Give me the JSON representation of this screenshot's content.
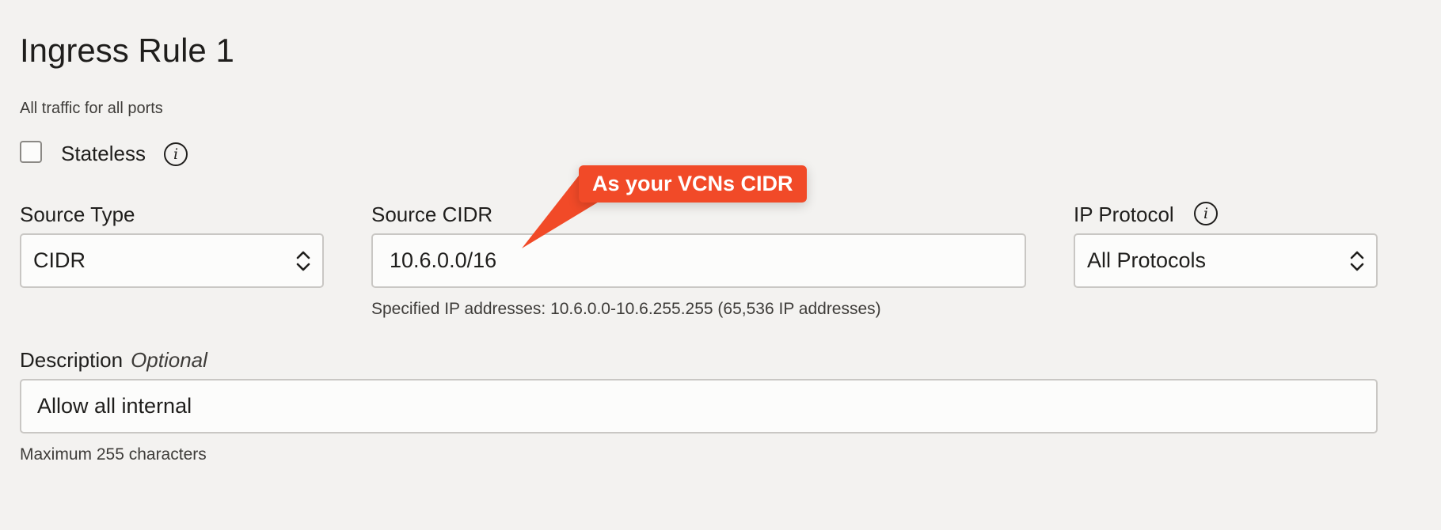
{
  "rule": {
    "title": "Ingress Rule 1",
    "subtitle": "All traffic for all ports"
  },
  "stateless": {
    "label": "Stateless",
    "checked": false,
    "info_icon": "info-icon"
  },
  "source_type": {
    "label": "Source Type",
    "value": "CIDR",
    "icon": "chevron-up-down-icon"
  },
  "source_cidr": {
    "label": "Source CIDR",
    "value": "10.6.0.0/16",
    "hint": "Specified IP addresses: 10.6.0.0-10.6.255.255 (65,536 IP addresses)"
  },
  "ip_protocol": {
    "label": "IP Protocol",
    "value": "All Protocols",
    "info_icon": "info-icon",
    "icon": "chevron-up-down-icon"
  },
  "description": {
    "label": "Description",
    "optional_label": "Optional",
    "value": "Allow all internal",
    "hint": "Maximum 255 characters"
  },
  "callout": {
    "text": "As your VCNs CIDR",
    "color": "#f14a28"
  },
  "colors": {
    "background": "#f3f2f0",
    "field_background": "#fcfcfb",
    "field_border": "#c9c7c4",
    "text": "#1f1e1c"
  }
}
